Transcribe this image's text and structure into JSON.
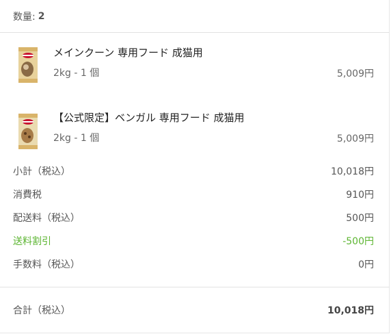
{
  "quantity": {
    "label": "数量:",
    "value": "2"
  },
  "items": [
    {
      "name": "メインクーン 専用フード 成猫用",
      "variant": "2kg - 1 個",
      "price": "5,009円",
      "icon": "cat-food-bag-icon"
    },
    {
      "name": "【公式限定】ベンガル 専用フード 成猫用",
      "variant": "2kg - 1 個",
      "price": "5,009円",
      "icon": "cat-food-bag-icon"
    }
  ],
  "summary": [
    {
      "label": "小計（税込）",
      "value": "10,018円"
    },
    {
      "label": "消費税",
      "value": "910円"
    },
    {
      "label": "配送料（税込）",
      "value": "500円"
    },
    {
      "label": "送料割引",
      "value": "-500円"
    },
    {
      "label": "手数料（税込）",
      "value": "0円"
    }
  ],
  "total": {
    "label": "合計（税込）",
    "value": "10,018円"
  },
  "colors": {
    "discount": "#5cb531",
    "brand_red": "#c8102e",
    "package_gold": "#d9b46a"
  }
}
